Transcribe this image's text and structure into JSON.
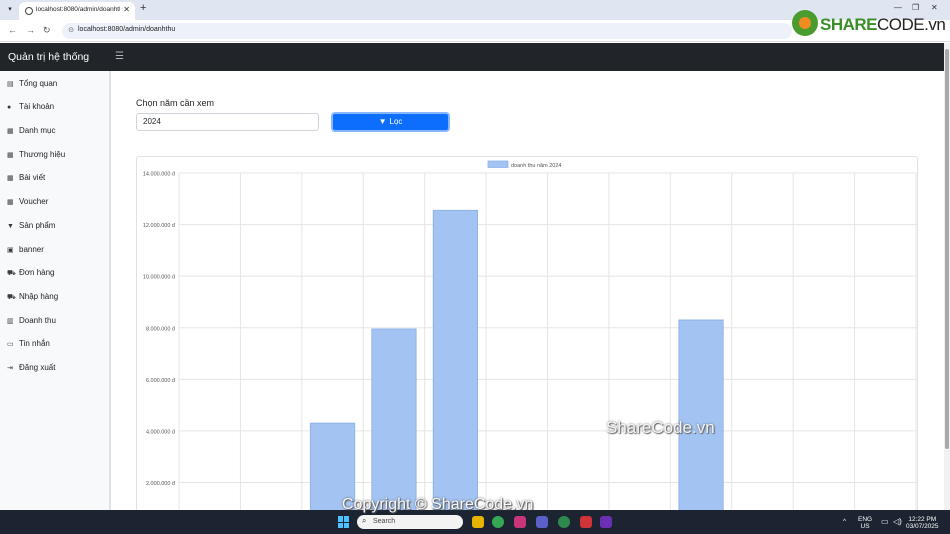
{
  "browser": {
    "tab_title": "localhost:8080/admin/doanhthu",
    "url": "localhost:8080/admin/doanhthu",
    "brand_share": "SHARE",
    "brand_code": "CODE.vn"
  },
  "header": {
    "title": "Quản trị hệ thống"
  },
  "sidebar": {
    "items": [
      {
        "label": "Tổng quan",
        "icon": "database-icon"
      },
      {
        "label": "Tài khoản",
        "icon": "user-icon"
      },
      {
        "label": "Danh mục",
        "icon": "table-icon"
      },
      {
        "label": "Thương hiệu",
        "icon": "table-icon"
      },
      {
        "label": "Bài viết",
        "icon": "table-icon"
      },
      {
        "label": "Voucher",
        "icon": "table-icon"
      },
      {
        "label": "Sản phẩm",
        "icon": "shirt-icon"
      },
      {
        "label": "banner",
        "icon": "image-icon"
      },
      {
        "label": "Đơn hàng",
        "icon": "cart-icon"
      },
      {
        "label": "Nhập hàng",
        "icon": "cart-icon"
      },
      {
        "label": "Doanh thu",
        "icon": "chart-icon"
      },
      {
        "label": "Tin nhắn",
        "icon": "message-icon"
      },
      {
        "label": "Đăng xuất",
        "icon": "logout-icon"
      }
    ]
  },
  "filter": {
    "label": "Chọn năm cần xem",
    "year_value": "2024",
    "button_label": "Lọc"
  },
  "chart_data": {
    "type": "bar",
    "series": [
      {
        "name": "doanh thu năm 2024",
        "color": "#a3c4f3",
        "values": [
          0,
          0,
          4300000,
          7950000,
          12550000,
          0,
          0,
          0,
          8300000,
          0,
          0,
          0
        ]
      }
    ],
    "ylim": [
      0,
      14000000
    ],
    "y_ticks": [
      "2.000.000 đ",
      "4.000.000 đ",
      "6.000.000 đ",
      "8.000.000 đ",
      "10.000.000 đ",
      "12.000.000 đ",
      "14.000.000 đ"
    ],
    "y_tick_values": [
      2000000,
      4000000,
      6000000,
      8000000,
      10000000,
      12000000,
      14000000
    ],
    "grid": true,
    "legend_position": "top"
  },
  "watermark": {
    "center": "ShareCode.vn",
    "bottom": "Copyright © ShareCode.vn"
  },
  "taskbar": {
    "search_placeholder": "Search",
    "lang_top": "ENG",
    "lang_bottom": "US",
    "time": "12:22 PM",
    "date": "03/07/2025"
  }
}
